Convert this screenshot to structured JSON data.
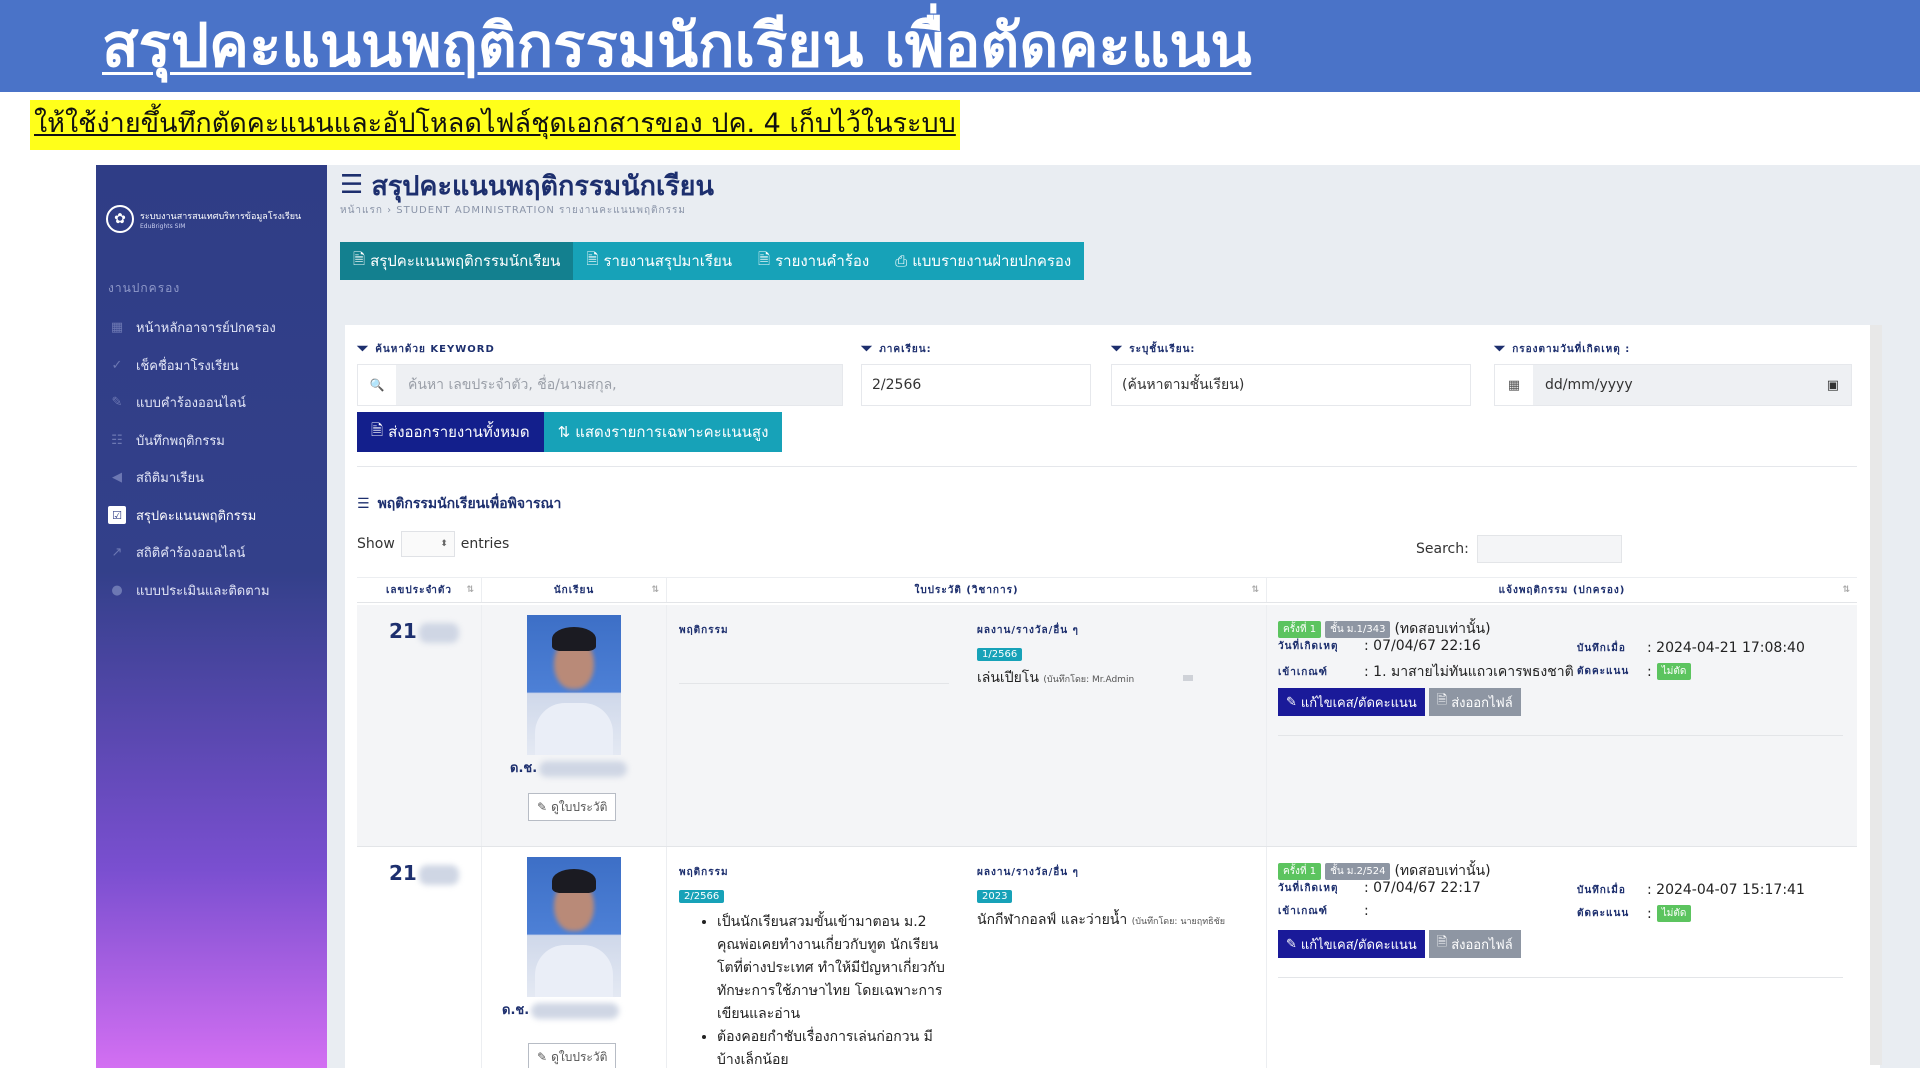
{
  "banner": {
    "title": "สรุปคะแนนพฤติกรรมนักเรียน เพื่อตัดคะแนน",
    "subtitle": "ให้ใช้ง่ายขึ้นทึกตัดคะแนนและอัปโหลดไฟล์ชุดเอกสารของ ปค. 4 เก็บไว้ในระบบ"
  },
  "sidebar": {
    "brand_name": "ระบบงานสารสนเทศบริหารข้อมูลโรงเรียน",
    "brand_sub": "EduBrights SIM",
    "section": "งานปกครอง",
    "items": [
      {
        "label": "หน้าหลักอาจารย์ปกครอง",
        "icon": "dashboard-icon",
        "glyph": "▦"
      },
      {
        "label": "เช็คชื่อมาโรงเรียน",
        "icon": "check-icon",
        "glyph": "✓"
      },
      {
        "label": "แบบคำร้องออนไลน์",
        "icon": "form-icon",
        "glyph": "✎"
      },
      {
        "label": "บันทึกพฤติกรรม",
        "icon": "users-icon",
        "glyph": "☷"
      },
      {
        "label": "สถิติมาเรียน",
        "icon": "megaphone-icon",
        "glyph": "◀"
      },
      {
        "label": "สรุปคะแนนพฤติกรรม",
        "icon": "checklist-icon",
        "glyph": "☑"
      },
      {
        "label": "สถิติคำร้องออนไลน์",
        "icon": "chart-icon",
        "glyph": "↗"
      },
      {
        "label": "แบบประเมินและติดตาม",
        "icon": "shield-icon",
        "glyph": "●"
      }
    ]
  },
  "page": {
    "title": "สรุปคะแนนพฤติกรรมนักเรียน",
    "breadcrumb": "หน้าแรก › STUDENT ADMINISTRATION รายงานคะแนนพฤติกรรม"
  },
  "tabs": [
    "สรุปคะแนนพฤติกรรมนักเรียน",
    "รายงานสรุปมาเรียน",
    "รายงานคำร้อง",
    "แบบรายงานฝ่ายปกครอง"
  ],
  "filters": {
    "keyword_label": "ค้นหาด้วย KEYWORD",
    "keyword_placeholder": "ค้นหา เลขประจำตัว, ชื่อ/นามสกุล,",
    "term_label": "ภาคเรียน:",
    "term_value": "2/2566",
    "class_label": "ระบุชั้นเรียน:",
    "class_value": "(ค้นหาตามชั้นเรียน)",
    "date_label": "กรองตามวันที่เกิดเหตุ :",
    "date_value": "dd/mm/yyyy"
  },
  "buttons": {
    "export_all": "ส่งออกรายงานทั้งหมด",
    "show_high": "แสดงรายการเฉพาะคะแนนสูง"
  },
  "section_title": "พฤติกรรมนักเรียนเพื่อพิจารณา",
  "datatable": {
    "show": "Show",
    "entries": "entries",
    "search": "Search:"
  },
  "table": {
    "headers": [
      "เลขประจำตัว",
      "นักเรียน",
      "ใบประวัติ (วิชาการ)",
      "แจ้งพฤติกรรม (ปกครอง)"
    ],
    "rows": [
      {
        "id_prefix": "21",
        "name_prefix": "ด.ช.",
        "history_button": "ดูใบประวัติ",
        "behavior_label": "พฤติกรรม",
        "behavior_term": "",
        "behavior_items": [],
        "award_label": "ผลงาน/รางวัล/อื่น ๆ",
        "award_term": "1/2566",
        "award_text": "เล่นเปียโน",
        "award_by": "(บันทึกโดย: Mr.Admin",
        "report": {
          "time_badge": "ครั้งที่ 1",
          "class_badge": "ชั้น ม.1/343",
          "note": "(ทดสอบเท่านั้น)",
          "incident_label": "วันที่เกิดเหตุ",
          "incident_value": ": 07/04/67 22:16",
          "rule_label": "เข้าเกณฑ์",
          "rule_value": ": 1. มาสายไม่ทันแถวเคารพธงชาติ",
          "recorded_label": "บันทึกเมื่อ",
          "recorded_value": ": 2024-04-21 17:08:40",
          "deduct_label": "ตัดคะแนน",
          "deduct_sep": ":",
          "deduct_badge": "ไม่ตัด",
          "edit_button": "แก้ไขเคส/ตัดคะแนน",
          "export_button": "ส่งออกไฟล์"
        }
      },
      {
        "id_prefix": "21",
        "name_prefix": "ด.ช.",
        "history_button": "ดูใบประวัติ",
        "behavior_label": "พฤติกรรม",
        "behavior_term": "2/2566",
        "behavior_items": [
          "เป็นนักเรียนสวมขั้นเข้ามาตอน ม.2 คุณพ่อเคยทำงานเกี่ยวกับทูต นักเรียนโตที่ต่างประเทศ ทำให้มีปัญหาเกี่ยวกับทักษะการใช้ภาษาไทย โดยเฉพาะการเขียนและอ่าน",
          "ต้องคอยกำชับเรื่องการเล่นก่อกวน มีบ้างเล็กน้อย"
        ],
        "award_label": "ผลงาน/รางวัล/อื่น ๆ",
        "award_term": "2023",
        "award_text": "นักกีฬากอลฟ์ และว่ายน้ำ",
        "award_by": "(บันทึกโดย: นายฤทธิชัย",
        "report": {
          "time_badge": "ครั้งที่ 1",
          "class_badge": "ชั้น ม.2/524",
          "note": "(ทดสอบเท่านั้น)",
          "incident_label": "วันที่เกิดเหตุ",
          "incident_value": ": 07/04/67 22:17",
          "rule_label": "เข้าเกณฑ์",
          "rule_value": ":",
          "recorded_label": "บันทึกเมื่อ",
          "recorded_value": ": 2024-04-07 15:17:41",
          "deduct_label": "ตัดคะแนน",
          "deduct_sep": ":",
          "deduct_badge": "ไม่ตัด",
          "edit_button": "แก้ไขเคส/ตัดคะแนน",
          "export_button": "ส่งออกไฟล์"
        }
      }
    ]
  }
}
